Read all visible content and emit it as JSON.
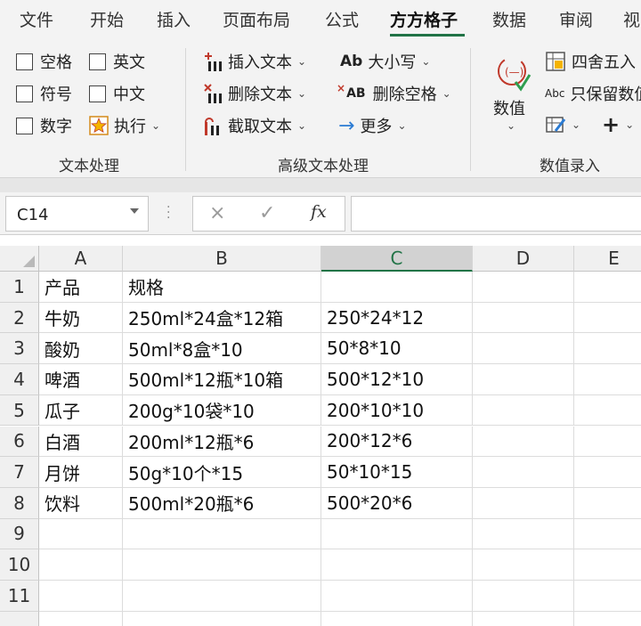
{
  "ribbon_tabs": {
    "items": [
      "文件",
      "开始",
      "插入",
      "页面布局",
      "公式",
      "方方格子",
      "数据",
      "审阅",
      "视"
    ],
    "active_index": 5,
    "accent_color": "#217346"
  },
  "ribbon": {
    "text_group": {
      "label": "文本处理",
      "checkboxes": [
        {
          "label": "空格",
          "checked": false
        },
        {
          "label": "英文",
          "checked": false
        },
        {
          "label": "符号",
          "checked": false
        },
        {
          "label": "中文",
          "checked": false
        },
        {
          "label": "数字",
          "checked": false
        }
      ],
      "execute_label": "执行"
    },
    "advanced_group": {
      "label": "高级文本处理",
      "insert_text": "插入文本",
      "delete_text": "删除文本",
      "extract_text": "截取文本",
      "case_label": "大小写",
      "case_icon_text": "Ab",
      "delete_space": "删除空格",
      "delete_space_icon_text": "AB",
      "more_label": "更多"
    },
    "number_group": {
      "label": "数值录入",
      "value_label": "数值",
      "round_label": "四舍五入",
      "keep_value_label": "只保留数值",
      "keep_value_icon_text": "Abc"
    }
  },
  "formula_bar": {
    "name_box": "C14",
    "cancel_icon": "×",
    "confirm_icon": "✓",
    "fx_label": "fx",
    "formula": ""
  },
  "grid": {
    "columns": [
      "A",
      "B",
      "C",
      "D",
      "E"
    ],
    "selected_column": "C",
    "row_numbers": [
      "1",
      "2",
      "3",
      "4",
      "5",
      "6",
      "7",
      "8",
      "9",
      "10",
      "11"
    ],
    "rows": [
      [
        "产品",
        "规格",
        ""
      ],
      [
        "牛奶",
        "250ml*24盒*12箱",
        "250*24*12"
      ],
      [
        "酸奶",
        "50ml*8盒*10",
        "50*8*10"
      ],
      [
        "啤酒",
        "500ml*12瓶*10箱",
        "500*12*10"
      ],
      [
        "瓜子",
        "200g*10袋*10",
        "200*10*10"
      ],
      [
        "白酒",
        "200ml*12瓶*6",
        "200*12*6"
      ],
      [
        "月饼",
        "50g*10个*15",
        "50*10*15"
      ],
      [
        "饮料",
        "500ml*20瓶*6",
        "500*20*6"
      ]
    ]
  }
}
